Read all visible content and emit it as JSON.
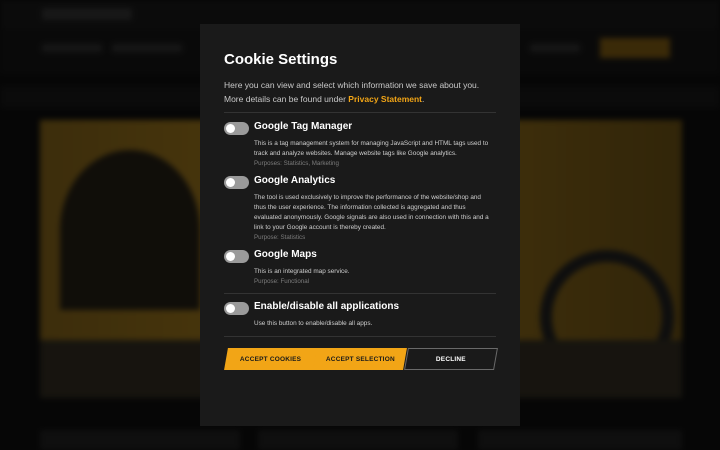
{
  "dialog": {
    "title": "Cookie Settings",
    "intro_text": "Here you can view and select which information we save about you.  More details can be found under",
    "privacy_link": "Privacy Statement",
    "intro_end": ".",
    "items": [
      {
        "name": "Google Tag Manager",
        "description": "This is a tag management system for managing JavaScript and HTML tags used to track and analyze websites. Manage website tags like Google analytics.",
        "purpose": "Purposes: Statistics, Marketing",
        "enabled": false
      },
      {
        "name": "Google Analytics",
        "description": "The tool is used exclusively to improve the performance of the website/shop and thus the user experience. The information collected is aggregated and thus evaluated anonymously. Google signals are also used in connection with this and a link to your Google account is thereby created.",
        "purpose": "Purpose: Statistics",
        "enabled": false
      },
      {
        "name": "Google Maps",
        "description": "This is an integrated map service.",
        "purpose": "Purpose: Functional",
        "enabled": false
      }
    ],
    "all_toggle": {
      "name": "Enable/disable all applications",
      "description": "Use this button to enable/disable all apps.",
      "enabled": false
    },
    "buttons": {
      "accept": "ACCEPT COOKIES",
      "selection": "ACCEPT SELECTION",
      "decline": "DECLINE"
    }
  },
  "colors": {
    "accent": "#f2a516",
    "dialog_bg": "#1a1a1a"
  }
}
